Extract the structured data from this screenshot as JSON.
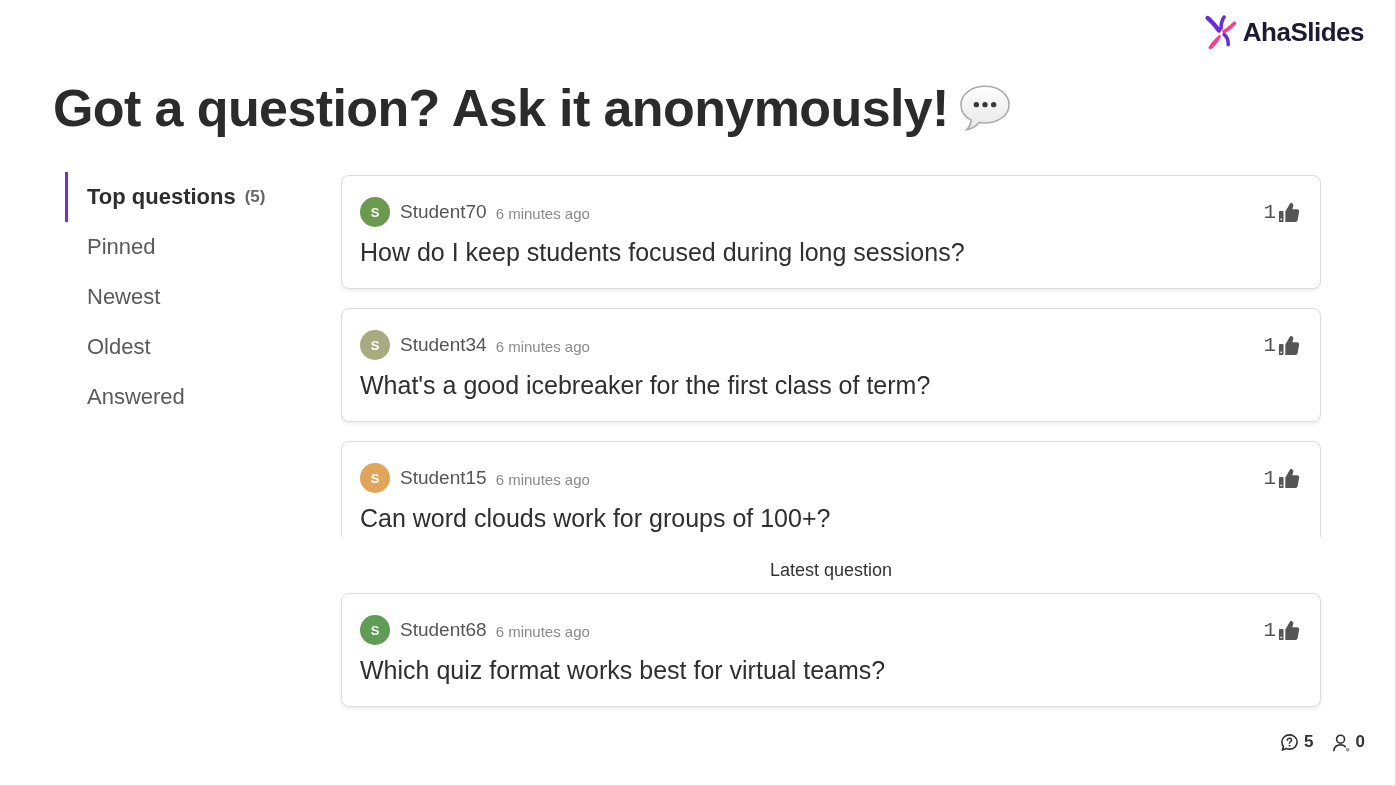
{
  "brand": {
    "name": "AhaSlides"
  },
  "heading": {
    "title": "Got a question? Ask it anonymously!"
  },
  "filters": [
    {
      "label": "Top questions",
      "count": "(5)",
      "selected": true
    },
    {
      "label": "Pinned",
      "selected": false
    },
    {
      "label": "Newest",
      "selected": false
    },
    {
      "label": "Oldest",
      "selected": false
    },
    {
      "label": "Answered",
      "selected": false
    }
  ],
  "questions": [
    {
      "avatar_letter": "S",
      "color": "#6b9a4f",
      "author": "Student70",
      "time": "6 minutes ago",
      "text": "How do I keep students focused during long sessions?",
      "likes": "1"
    },
    {
      "avatar_letter": "S",
      "color": "#a8ab80",
      "author": "Student34",
      "time": "6 minutes ago",
      "text": "What's a good icebreaker for the first class of term?",
      "likes": "1"
    },
    {
      "avatar_letter": "S",
      "color": "#e0a45a",
      "author": "Student15",
      "time": "6 minutes ago",
      "text": "Can word clouds work for groups of 100+?",
      "likes": "1"
    }
  ],
  "latest": {
    "label": "Latest question",
    "question": {
      "avatar_letter": "S",
      "color": "#5f9c55",
      "author": "Student68",
      "time": "6 minutes ago",
      "text": "Which quiz format works best for virtual teams?",
      "likes": "1"
    }
  },
  "status_bar": {
    "questions": "5",
    "participants": "0"
  }
}
